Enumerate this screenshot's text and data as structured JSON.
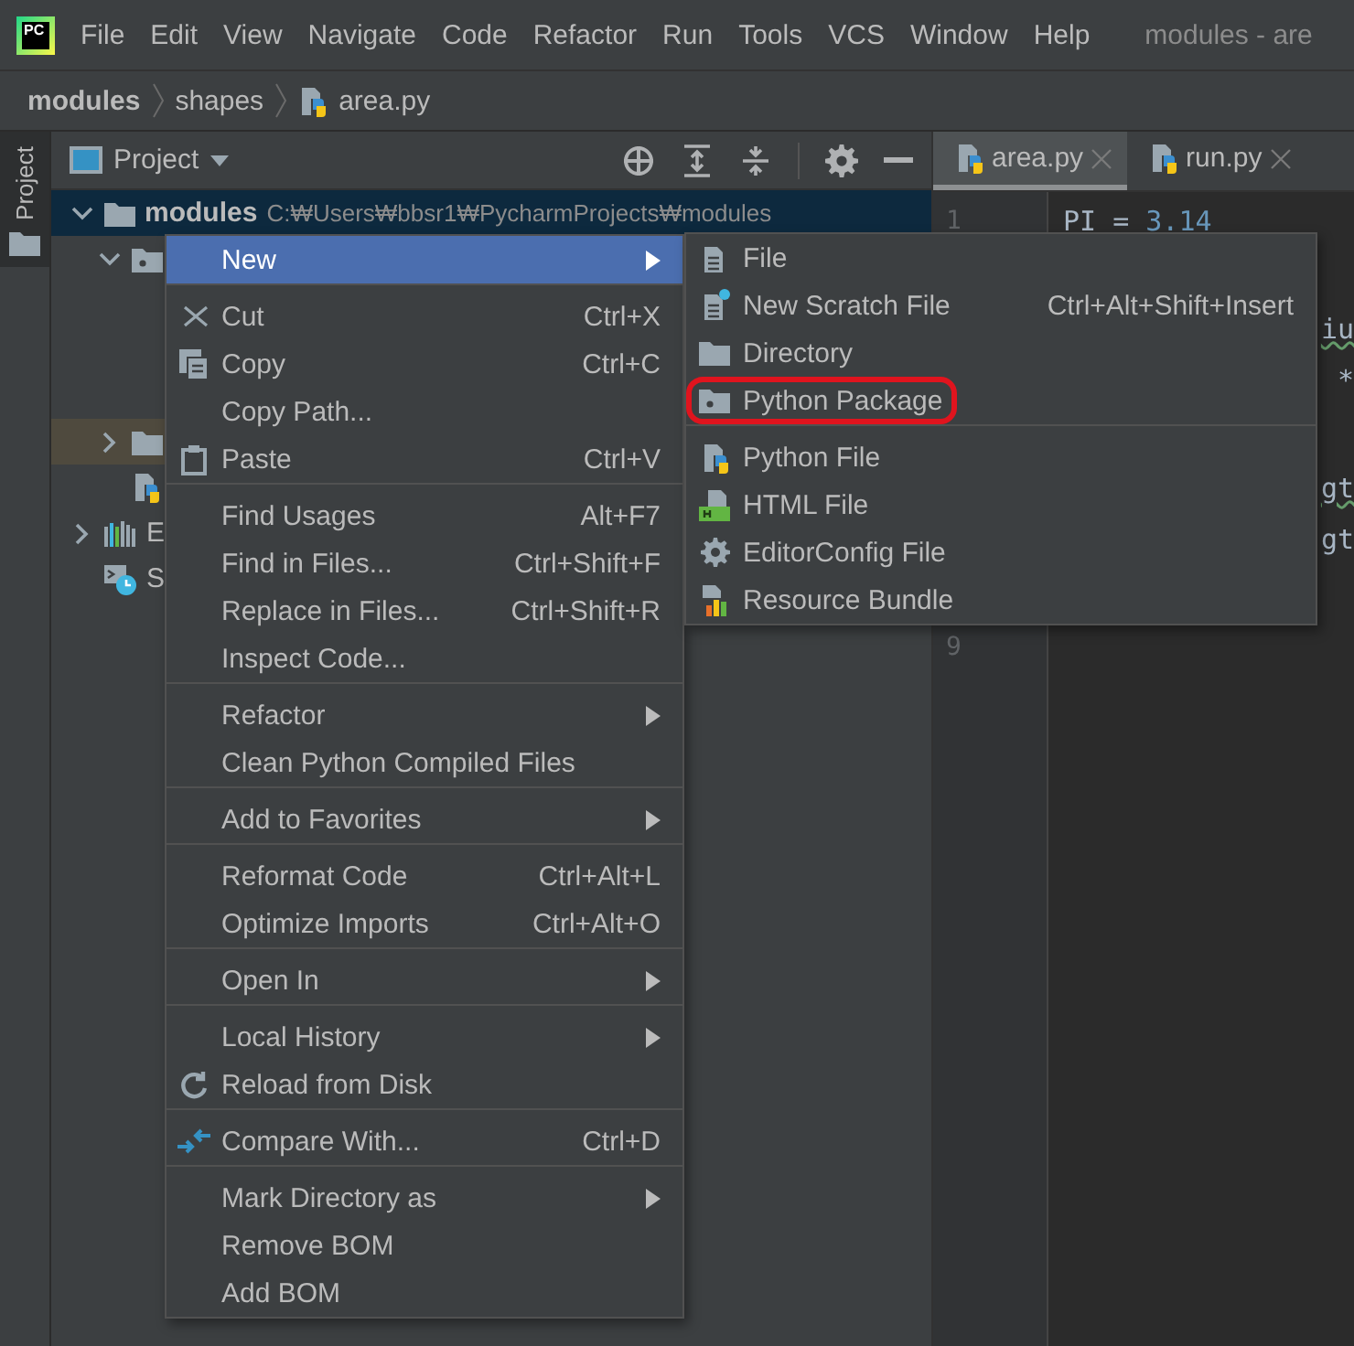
{
  "app": {
    "logo": "PC",
    "menus": [
      "File",
      "Edit",
      "View",
      "Navigate",
      "Code",
      "Refactor",
      "Run",
      "Tools",
      "VCS",
      "Window",
      "Help"
    ],
    "title": "modules - are"
  },
  "breadcrumbs": [
    {
      "label": "modules",
      "kind": "project"
    },
    {
      "label": "shapes",
      "kind": "folder"
    },
    {
      "label": "area.py",
      "kind": "pyfile"
    }
  ],
  "tool_stripe": [
    {
      "label": "Project",
      "selected": true
    }
  ],
  "project_panel": {
    "title": "Project"
  },
  "tree": [
    {
      "label": "modules",
      "path": "C:₩Users₩bbsr1₩PycharmProjects₩modules",
      "kind": "folder",
      "expanded": true,
      "selected": true,
      "children": [
        {
          "kind": "package",
          "expanded": true,
          "highlighted": false
        },
        {
          "kind": "folder",
          "expanded": false,
          "highlighted": true
        },
        {
          "kind": "pyfile",
          "highlighted": false
        }
      ]
    },
    {
      "label": "E",
      "kind": "library",
      "expanded": false,
      "selected": false
    },
    {
      "label": "S",
      "kind": "scratches",
      "selected": false
    }
  ],
  "editor_tabs": [
    {
      "label": "area.py",
      "selected": true
    },
    {
      "label": "run.py",
      "selected": false
    }
  ],
  "code_lines": [
    {
      "number": "1",
      "tokens": [
        {
          "kind": "name",
          "text": "PI"
        },
        {
          "kind": "operator",
          "text": " = "
        },
        {
          "kind": "number",
          "text": "3.14"
        }
      ]
    },
    {
      "covered": true,
      "after_hidden_line": true,
      "tokens": [
        {
          "kind": "name",
          "text": "iu",
          "typo": true
        }
      ]
    },
    {
      "covered": true,
      "tokens": [
        {
          "kind": "operator",
          "text": "*"
        }
      ]
    },
    {
      "covered": true,
      "after_hidden_line": true,
      "tokens": [
        {
          "kind": "name",
          "text": "gt",
          "typo": true
        }
      ]
    },
    {
      "covered": true,
      "tokens": [
        {
          "kind": "name",
          "text": "gt",
          "typo": false
        }
      ]
    },
    {
      "number": "9",
      "after_hidden_line": true
    }
  ],
  "context_menu": {
    "groups": [
      [
        {
          "label": "New",
          "kind": "plain",
          "submenu": true,
          "selected": true
        }
      ],
      [
        {
          "label": "Cut",
          "shortcut": "Ctrl+X",
          "kind": "cut",
          "selected": false
        },
        {
          "label": "Copy",
          "shortcut": "Ctrl+C",
          "kind": "copy",
          "selected": false
        },
        {
          "label": "Copy Path...",
          "kind": "plain",
          "selected": false
        },
        {
          "label": "Paste",
          "shortcut": "Ctrl+V",
          "kind": "paste",
          "selected": false
        }
      ],
      [
        {
          "label": "Find Usages",
          "shortcut": "Alt+F7",
          "kind": "plain",
          "selected": false
        },
        {
          "label": "Find in Files...",
          "shortcut": "Ctrl+Shift+F",
          "kind": "plain",
          "selected": false
        },
        {
          "label": "Replace in Files...",
          "shortcut": "Ctrl+Shift+R",
          "kind": "plain",
          "selected": false
        },
        {
          "label": "Inspect Code...",
          "kind": "plain",
          "selected": false
        }
      ],
      [
        {
          "label": "Refactor",
          "kind": "plain",
          "submenu": true,
          "selected": false
        },
        {
          "label": "Clean Python Compiled Files",
          "kind": "plain",
          "selected": false
        }
      ],
      [
        {
          "label": "Add to Favorites",
          "kind": "plain",
          "submenu": true,
          "selected": false
        }
      ],
      [
        {
          "label": "Reformat Code",
          "shortcut": "Ctrl+Alt+L",
          "kind": "plain",
          "selected": false
        },
        {
          "label": "Optimize Imports",
          "shortcut": "Ctrl+Alt+O",
          "kind": "plain",
          "selected": false
        }
      ],
      [
        {
          "label": "Open In",
          "kind": "plain",
          "submenu": true,
          "selected": false
        }
      ],
      [
        {
          "label": "Local History",
          "kind": "plain",
          "submenu": true,
          "selected": false
        },
        {
          "label": "Reload from Disk",
          "kind": "reload",
          "selected": false
        }
      ],
      [
        {
          "label": "Compare With...",
          "shortcut": "Ctrl+D",
          "kind": "compare",
          "selected": false
        }
      ],
      [
        {
          "label": "Mark Directory as",
          "kind": "plain",
          "submenu": true,
          "selected": false
        },
        {
          "label": "Remove BOM",
          "kind": "plain",
          "selected": false
        },
        {
          "label": "Add BOM",
          "kind": "plain",
          "selected": false
        }
      ]
    ]
  },
  "new_submenu": {
    "groups": [
      [
        {
          "label": "File",
          "kind": "file",
          "circled": false
        },
        {
          "label": "New Scratch File",
          "kind": "scratch",
          "shortcut": "Ctrl+Alt+Shift+Insert",
          "circled": false
        },
        {
          "label": "Directory",
          "kind": "folder",
          "circled": false
        },
        {
          "label": "Python Package",
          "kind": "package",
          "circled": true
        }
      ],
      [
        {
          "label": "Python File",
          "kind": "pyfile",
          "circled": false
        },
        {
          "label": "HTML File",
          "kind": "html",
          "circled": false
        },
        {
          "label": "EditorConfig File",
          "kind": "gear",
          "circled": false
        },
        {
          "label": "Resource Bundle",
          "kind": "bundle",
          "circled": false
        }
      ]
    ]
  }
}
